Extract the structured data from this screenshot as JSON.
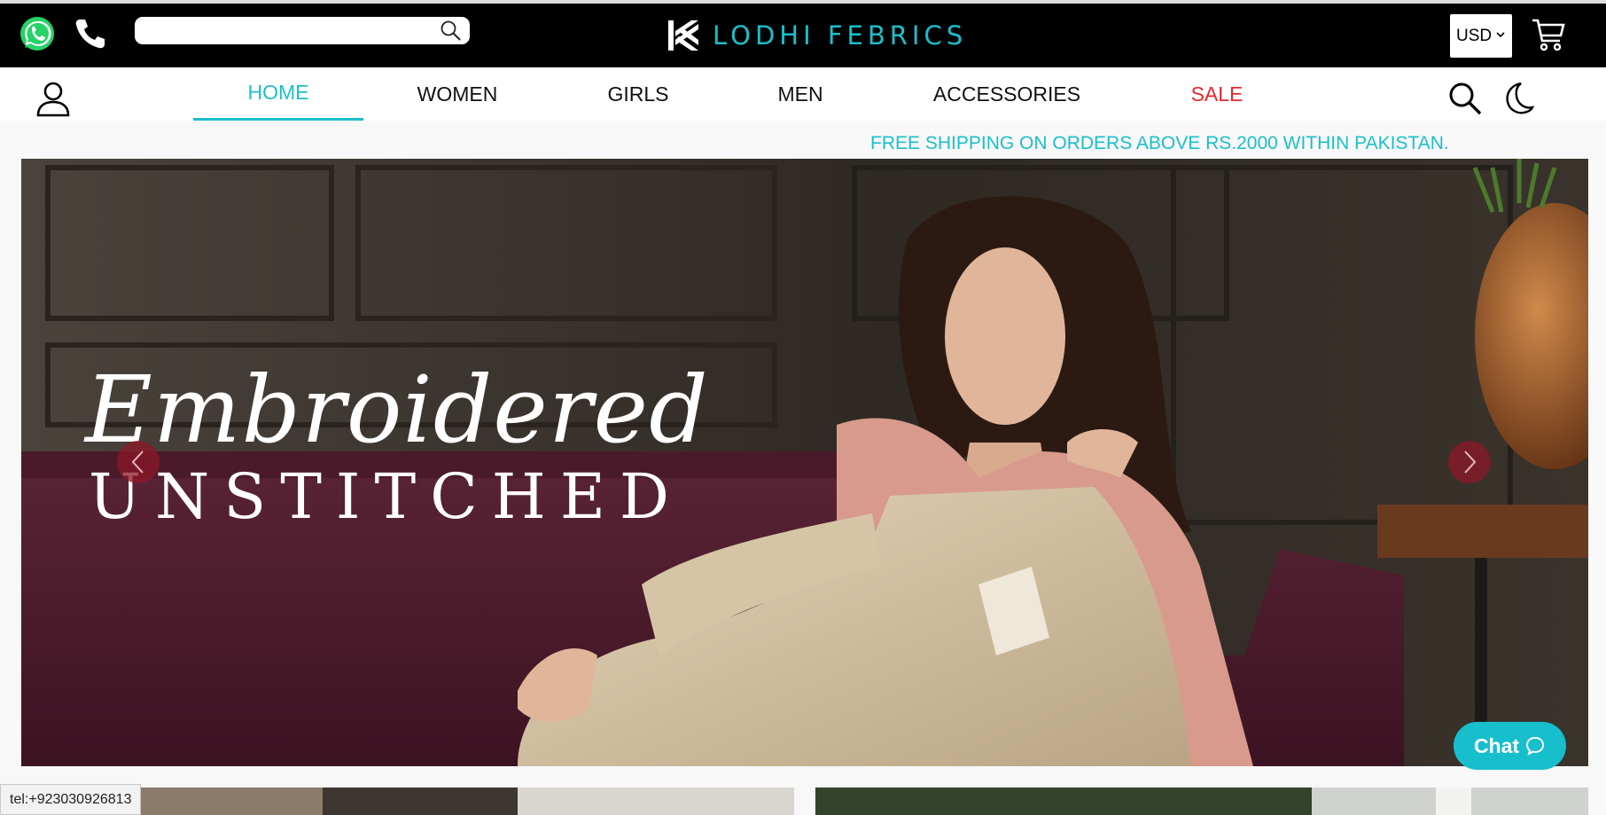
{
  "brand": {
    "name": "LODHI FEBRICS",
    "accent": "#1cbfcb"
  },
  "topbar": {
    "search_placeholder": "",
    "currency": "USD",
    "icons": [
      "whatsapp-icon",
      "phone-icon",
      "search-icon",
      "cart-icon"
    ]
  },
  "nav": {
    "items": [
      {
        "label": "HOME",
        "active": true
      },
      {
        "label": "WOMEN",
        "active": false
      },
      {
        "label": "GIRLS",
        "active": false
      },
      {
        "label": "MEN",
        "active": false
      },
      {
        "label": "ACCESSORIES",
        "active": false
      },
      {
        "label": "SALE",
        "active": false,
        "color": "#e8262d"
      }
    ],
    "icons": [
      "user-icon",
      "search-icon",
      "moon-icon"
    ]
  },
  "announcement": "FREE SHIPPING ON ORDERS ABOVE RS.2000 WITHIN PAKISTAN.",
  "hero": {
    "headline_script": "Embroidered",
    "headline_caps": "UNSTITCHED"
  },
  "chat": {
    "label": "Chat"
  },
  "status_bar": {
    "link": "tel:+923030926813"
  }
}
